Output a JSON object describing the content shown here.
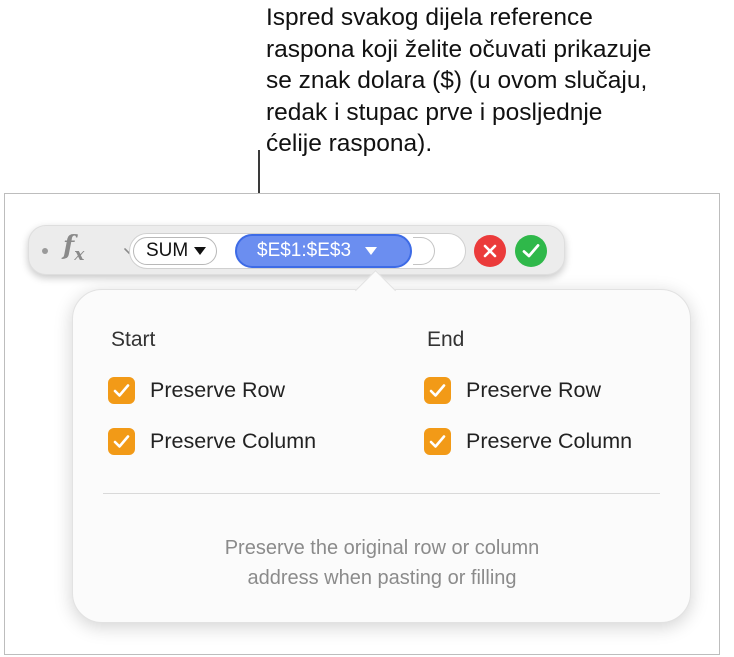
{
  "callout": {
    "text": "Ispred svakog dijela reference\nraspona koji želite očuvati prikazuje\nse znak dolara ($) (u ovom slučaju,\nredak i stupac prve i posljednje\nćelije raspona)."
  },
  "formula_bar": {
    "fx_label": "f",
    "fx_sub": "x",
    "function_name": "SUM",
    "range_reference": "$E$1:$E$3",
    "icons": [
      "grip-dot-icon",
      "function-icon",
      "chevron-down-icon",
      "cancel-icon",
      "confirm-icon"
    ],
    "colors": {
      "range_pill": "#6b8ef0",
      "cancel": "#eb3b3b",
      "confirm": "#2fb84a"
    }
  },
  "popover": {
    "start": {
      "heading": "Start",
      "preserve_row": {
        "label": "Preserve Row",
        "checked": true
      },
      "preserve_column": {
        "label": "Preserve Column",
        "checked": true
      }
    },
    "end": {
      "heading": "End",
      "preserve_row": {
        "label": "Preserve Row",
        "checked": true
      },
      "preserve_column": {
        "label": "Preserve Column",
        "checked": true
      }
    },
    "help_text": "Preserve the original row or column\naddress when pasting or filling",
    "checkbox_color": "#f29a17"
  }
}
